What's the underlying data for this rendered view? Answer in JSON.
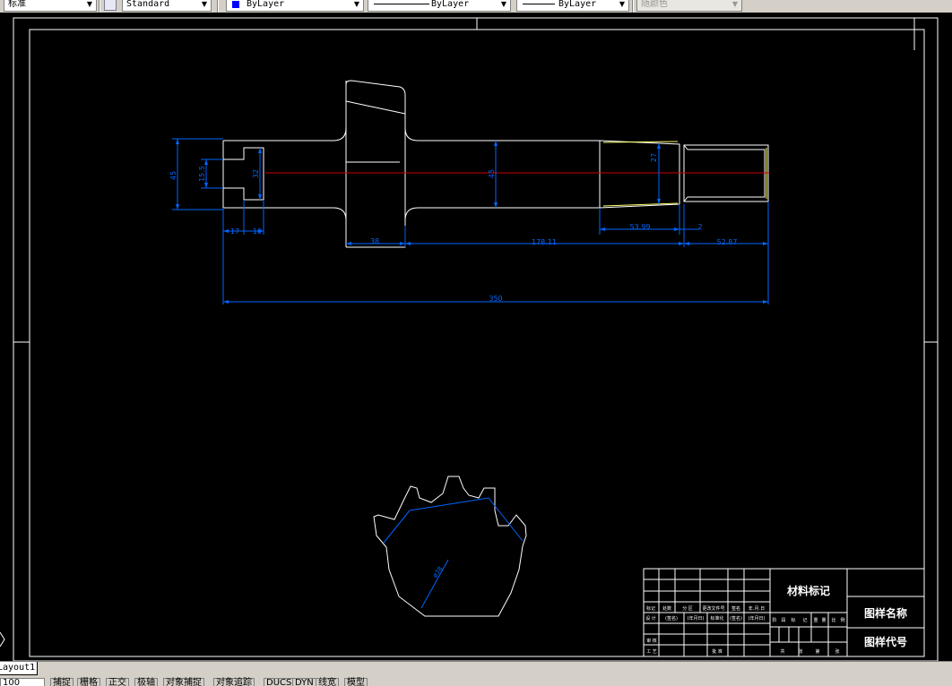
{
  "toolbar": {
    "text_style": "标准",
    "dim_style": "Standard",
    "color": "ByLayer",
    "linetype": "ByLayer",
    "lineweight": "ByLayer",
    "plotstyle": "随颜色",
    "colors": {
      "bylayer_swatch": "#0000ff"
    }
  },
  "drawing": {
    "dimensions": {
      "d45_left": "45",
      "d15_5": "15.5",
      "d32": "32",
      "d45_mid": "45",
      "d27": "27",
      "d17": "17",
      "d10": "10",
      "d38": "38",
      "d178_11": "178.11",
      "d53_99": "53.99",
      "d2": "2",
      "d52_87": "52.87",
      "d350": "350",
      "d_gear": "ø38"
    },
    "colors": {
      "background": "#000000",
      "lines": "#ffffff",
      "dimension": "#0066ff",
      "centerline": "#cc0000",
      "accent": "#ffff66"
    }
  },
  "title_block": {
    "material": "材料标记",
    "drawing_name": "图样名称",
    "drawing_code": "图样代号",
    "row1": [
      "标记",
      "处数",
      "分 区",
      "更改文件号",
      "签名",
      "年.月.日"
    ],
    "row2": [
      "设 计",
      "(签名)",
      "(年月日)",
      "标准化",
      "(签名)",
      "(年月日)"
    ],
    "stage_row": [
      "阶",
      "段",
      "标",
      "记",
      "重",
      "量",
      "比",
      "例"
    ],
    "sheet_row": [
      "共",
      "张",
      "第",
      "张"
    ],
    "review": "审 核",
    "process": "工 艺",
    "approve": "批 准"
  },
  "tabs": {
    "layout1": "Layout1"
  },
  "status": {
    "coords": "100",
    "snap": "捕捉",
    "grid": "栅格",
    "ortho": "正交",
    "polar": "极轴",
    "osnap": "对象捕捉",
    "otrack": "对象追踪",
    "ducs": "DUCS",
    "dyn": "DYN",
    "lwt": "线宽",
    "model": "模型"
  }
}
